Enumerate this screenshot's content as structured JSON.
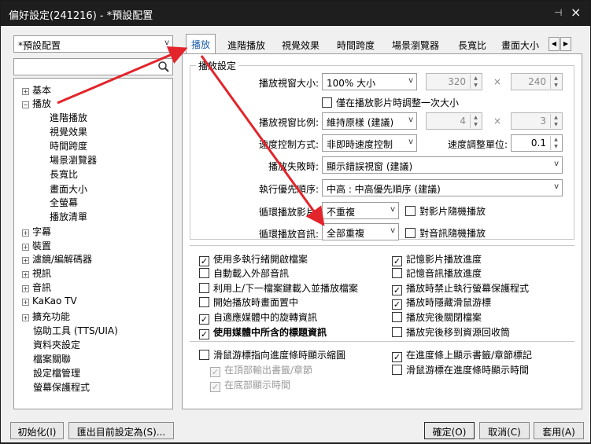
{
  "window": {
    "title": "偏好設定(241216) - *預設配置",
    "pin_icon": "pin-icon",
    "close_icon": "close-icon"
  },
  "profile": {
    "value": "*預設配置"
  },
  "search": {
    "value": "",
    "icon": "search-icon"
  },
  "tree": {
    "items": [
      {
        "label": "基本",
        "expander": "+"
      },
      {
        "label": "播放",
        "expander": "−"
      },
      {
        "label": "進階播放"
      },
      {
        "label": "視覺效果"
      },
      {
        "label": "時間跨度"
      },
      {
        "label": "場景瀏覽器"
      },
      {
        "label": "長寬比"
      },
      {
        "label": "畫面大小"
      },
      {
        "label": "全螢幕"
      },
      {
        "label": "播放清單"
      },
      {
        "label": "字幕",
        "expander": "+"
      },
      {
        "label": "裝置",
        "expander": "+"
      },
      {
        "label": "濾鏡/編解碼器",
        "expander": "+"
      },
      {
        "label": "視訊",
        "expander": "+"
      },
      {
        "label": "音訊",
        "expander": "+"
      },
      {
        "label": "KaKao TV",
        "expander": "+"
      },
      {
        "label": "擴充功能",
        "expander": "+"
      },
      {
        "label": "協助工具 (TTS/UIA)"
      },
      {
        "label": "資料夾設定"
      },
      {
        "label": "檔案關聯"
      },
      {
        "label": "設定檔管理"
      },
      {
        "label": "螢幕保護程式"
      }
    ]
  },
  "tabs": [
    {
      "label": "播放"
    },
    {
      "label": "進階播放"
    },
    {
      "label": "視覺效果"
    },
    {
      "label": "時間跨度"
    },
    {
      "label": "場景瀏覽器"
    },
    {
      "label": "長寬比"
    },
    {
      "label": "畫面大小"
    }
  ],
  "tab_scroll": {
    "left": "◀",
    "right": "▶"
  },
  "playback": {
    "group_title": "播放設定",
    "window_size_label": "播放視窗大小:",
    "window_size_value": "100% 大小",
    "width_value": "320",
    "height_value": "240",
    "times": "×",
    "adjust_once_label": "僅在播放影片時調整一次大小",
    "ratio_label": "播放視窗比例:",
    "ratio_value": "維持原樣 (建議)",
    "ratio_w": "4",
    "ratio_h": "3",
    "speed_control_label": "速度控制方式:",
    "speed_control_value": "非即時速度控制",
    "speed_unit_label": "速度調整單位:",
    "speed_unit_value": "0.1",
    "fail_label": "播放失敗時:",
    "fail_value": "顯示錯誤視窗 (建議)",
    "priority_label": "執行優先順序:",
    "priority_value": "中高 : 中高優先順序 (建議)",
    "loop_video_label": "循環播放影片:",
    "loop_video_value": "不重複",
    "random_video_label": "對影片隨機播放",
    "loop_audio_label": "循環播放音訊:",
    "loop_audio_value": "全部重複",
    "random_audio_label": "對音訊隨機播放"
  },
  "options_left": [
    {
      "label": "使用多執行緒開啟檔案",
      "checked": true
    },
    {
      "label": "自動載入外部音訊",
      "checked": false
    },
    {
      "label": "利用上/下一檔案鍵載入並播放檔案",
      "checked": false
    },
    {
      "label": "開始播放時畫面置中",
      "checked": false
    },
    {
      "label": "自適應媒體中的旋轉資訊",
      "checked": true
    },
    {
      "label": "使用媒體中所含的標題資訊",
      "checked": true
    }
  ],
  "options_right": [
    {
      "label": "記憶影片播放進度",
      "checked": true
    },
    {
      "label": "記憶音訊播放進度",
      "checked": false
    },
    {
      "label": "播放時禁止執行螢幕保護程式",
      "checked": true
    },
    {
      "label": "播放時隱藏滑鼠游標",
      "checked": true
    },
    {
      "label": "播放完後關閉檔案",
      "checked": false
    },
    {
      "label": "播放完後移到資源回收筒",
      "checked": false
    }
  ],
  "hover_options": {
    "thumbnail_label": "滑鼠游標指向進度條時顯示縮圖",
    "top_chapter_label": "在頂部輸出書籤/章節",
    "bottom_time_label": "在底部顯示時間",
    "bookmark_label": "在進度條上顯示書籤/章節標記",
    "hover_time_label": "滑鼠游標在進度條時顯示時間",
    "check": "✓"
  },
  "buttons": {
    "init": "初始化(I)",
    "export": "匯出目前設定為(S)...",
    "ok": "確定(O)",
    "cancel": "取消(C)",
    "apply": "套用(A)"
  },
  "colors": {
    "annotation_arrow": "#e3242b"
  }
}
